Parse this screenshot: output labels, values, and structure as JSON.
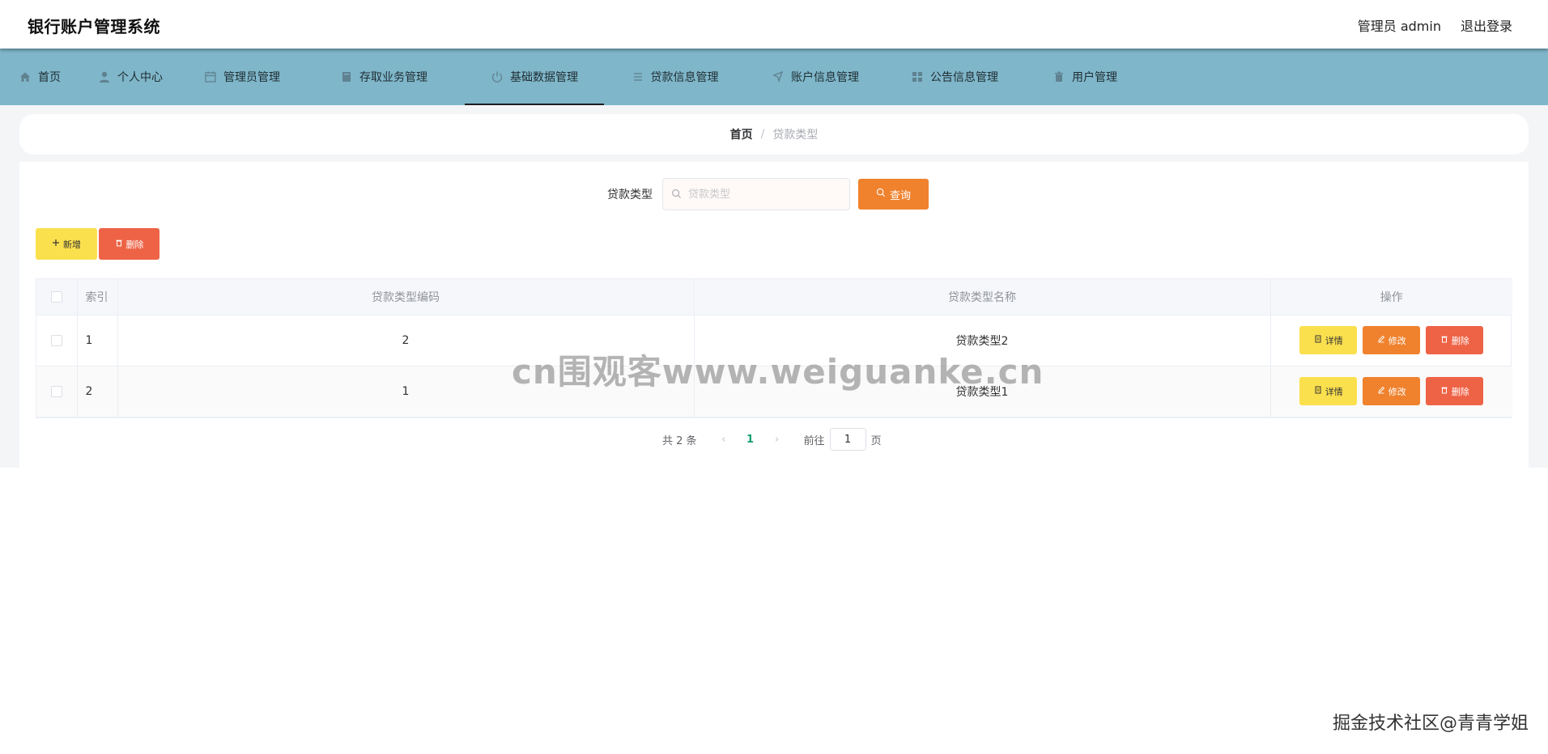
{
  "header": {
    "title": "银行账户管理系统",
    "user_label": "管理员 admin",
    "logout_label": "退出登录"
  },
  "nav": {
    "items": [
      {
        "label": "首页",
        "icon": "home-icon"
      },
      {
        "label": "个人中心",
        "icon": "user-icon"
      },
      {
        "label": "管理员管理",
        "icon": "calendar-icon"
      },
      {
        "label": "存取业务管理",
        "icon": "book-icon"
      },
      {
        "label": "基础数据管理",
        "icon": "power-icon",
        "active": true
      },
      {
        "label": "贷款信息管理",
        "icon": "list-icon"
      },
      {
        "label": "账户信息管理",
        "icon": "location-icon"
      },
      {
        "label": "公告信息管理",
        "icon": "grid-icon"
      },
      {
        "label": "用户管理",
        "icon": "trash-icon"
      }
    ]
  },
  "breadcrumb": {
    "home": "首页",
    "separator": "/",
    "current": "贷款类型"
  },
  "search": {
    "label": "贷款类型",
    "placeholder": "贷款类型",
    "value": "",
    "button_label": "查询"
  },
  "actions": {
    "add_label": "新增",
    "delete_label": "删除"
  },
  "table": {
    "columns": [
      "索引",
      "贷款类型编码",
      "贷款类型名称",
      "操作"
    ],
    "rows": [
      {
        "index": "1",
        "code": "2",
        "name": "贷款类型2"
      },
      {
        "index": "2",
        "code": "1",
        "name": "贷款类型1"
      }
    ],
    "row_actions": {
      "detail_label": "详情",
      "edit_label": "修改",
      "delete_label": "删除"
    }
  },
  "pagination": {
    "total_text": "共 2 条",
    "current_page": "1",
    "goto_label": "前往",
    "goto_value": "1",
    "goto_suffix": "页"
  },
  "overlay": {
    "watermark": "cn围观客www.weiguanke.cn",
    "credit": "掘金技术社区@青青学姐"
  },
  "colors": {
    "nav_bg": "#7fb6c9",
    "primary_orange": "#f0822e",
    "warning_yellow": "#fbe04e",
    "danger_red": "#ee6346",
    "active_page": "#13a06f"
  }
}
